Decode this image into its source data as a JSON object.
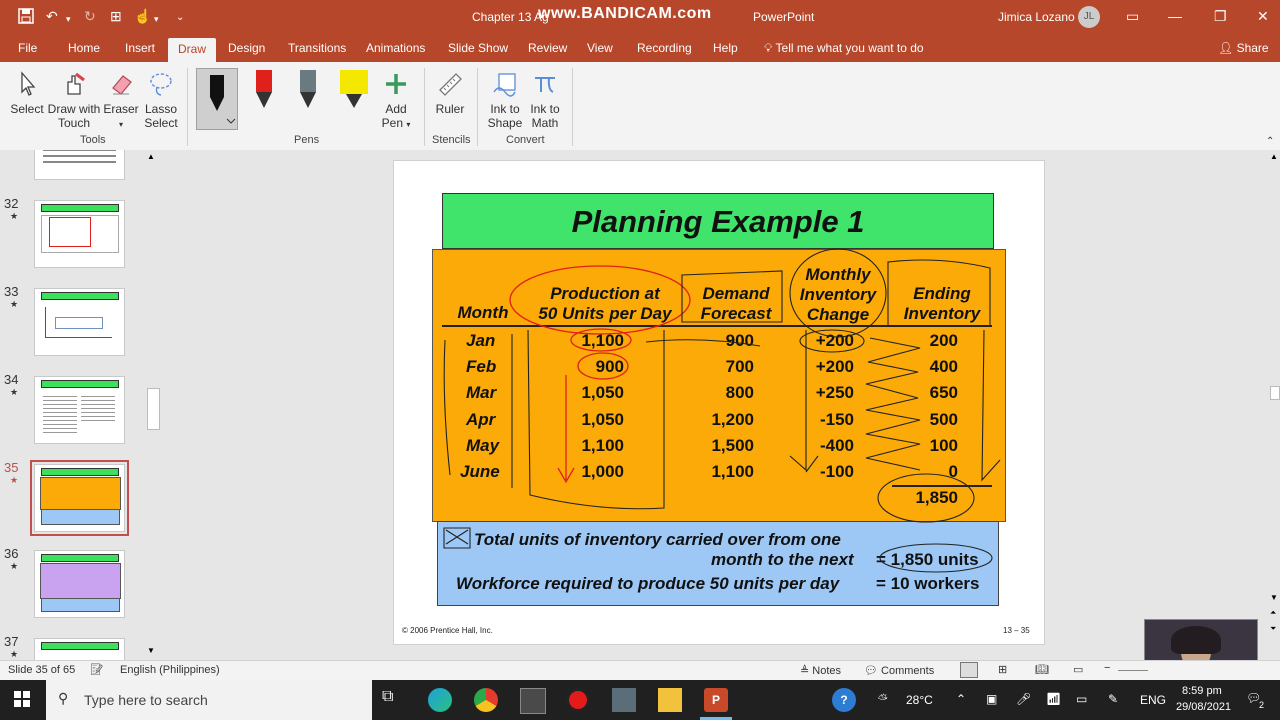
{
  "titlebar": {
    "doc_title": "Chapter 13 Ag",
    "watermark": "www.BANDICAM.com",
    "app_name": "PowerPoint",
    "user_name": "Jimica Lozano",
    "user_initials": "JL"
  },
  "tabs": [
    "File",
    "Home",
    "Insert",
    "Draw",
    "Design",
    "Transitions",
    "Animations",
    "Slide Show",
    "Review",
    "View",
    "Recording",
    "Help"
  ],
  "active_tab": "Draw",
  "tell_me": "Tell me what you want to do",
  "share": "Share",
  "ribbon": {
    "tools": {
      "select": "Select",
      "draw_touch_1": "Draw with",
      "draw_touch_2": "Touch",
      "eraser": "Eraser",
      "lasso_1": "Lasso",
      "lasso_2": "Select",
      "group": "Tools"
    },
    "pens": {
      "add_pen_1": "Add",
      "add_pen_2": "Pen",
      "group": "Pens"
    },
    "stencils": {
      "ruler": "Ruler",
      "group": "Stencils"
    },
    "convert": {
      "ink_shape_1": "Ink to",
      "ink_shape_2": "Shape",
      "ink_math_1": "Ink to",
      "ink_math_2": "Math",
      "group": "Convert"
    },
    "colors": {
      "pen_black": "#111111",
      "pen_red": "#e0201a",
      "pen_gray": "#6b7a80",
      "highlighter": "#f5e800"
    }
  },
  "thumbnails": [
    {
      "num": "32",
      "star": "★"
    },
    {
      "num": "33",
      "star": "★"
    },
    {
      "num": "34",
      "star": "★"
    },
    {
      "num": "35",
      "star": "★"
    },
    {
      "num": "36",
      "star": "★"
    },
    {
      "num": "37",
      "star": "★"
    }
  ],
  "slide": {
    "title": "Planning Example 1",
    "headers": {
      "month": "Month",
      "production_1": "Production at",
      "production_2": "50 Units per Day",
      "demand_1": "Demand",
      "demand_2": "Forecast",
      "change_1": "Monthly",
      "change_2": "Inventory",
      "change_3": "Change",
      "ending_1": "Ending",
      "ending_2": "Inventory"
    },
    "rows": [
      {
        "month": "Jan",
        "production": "1,100",
        "demand": "900",
        "change": "+200",
        "ending": "200"
      },
      {
        "month": "Feb",
        "production": "900",
        "demand": "700",
        "change": "+200",
        "ending": "400"
      },
      {
        "month": "Mar",
        "production": "1,050",
        "demand": "800",
        "change": "+250",
        "ending": "650"
      },
      {
        "month": "Apr",
        "production": "1,050",
        "demand": "1,200",
        "change": "-150",
        "ending": "500"
      },
      {
        "month": "May",
        "production": "1,100",
        "demand": "1,500",
        "change": "-400",
        "ending": "100"
      },
      {
        "month": "June",
        "production": "1,000",
        "demand": "1,100",
        "change": "-100",
        "ending": "0"
      }
    ],
    "total": "1,850",
    "footer": {
      "line1_a": "Total units of inventory carried over from one",
      "line1_b": "month to the next",
      "line1_val": "= 1,850 units",
      "line2": "Workforce required to produce 50 units per day",
      "line2_val": "= 10 workers"
    },
    "copyright": "© 2006 Prentice Hall, Inc.",
    "page_ref": "13 – 35",
    "colors": {
      "title_bg": "#40e46a",
      "table_bg": "#fbaa08",
      "footer_bg": "#9dc8f5",
      "ink": "#e0201a"
    }
  },
  "statusbar": {
    "slide_info": "Slide 35 of 65",
    "language": "English (Philippines)",
    "notes": "Notes",
    "comments": "Comments"
  },
  "taskbar": {
    "search_placeholder": "Type here to search",
    "temperature": "28°C",
    "language": "ENG",
    "time": "8:59 pm",
    "date": "29/08/2021",
    "notification_count": "2"
  }
}
